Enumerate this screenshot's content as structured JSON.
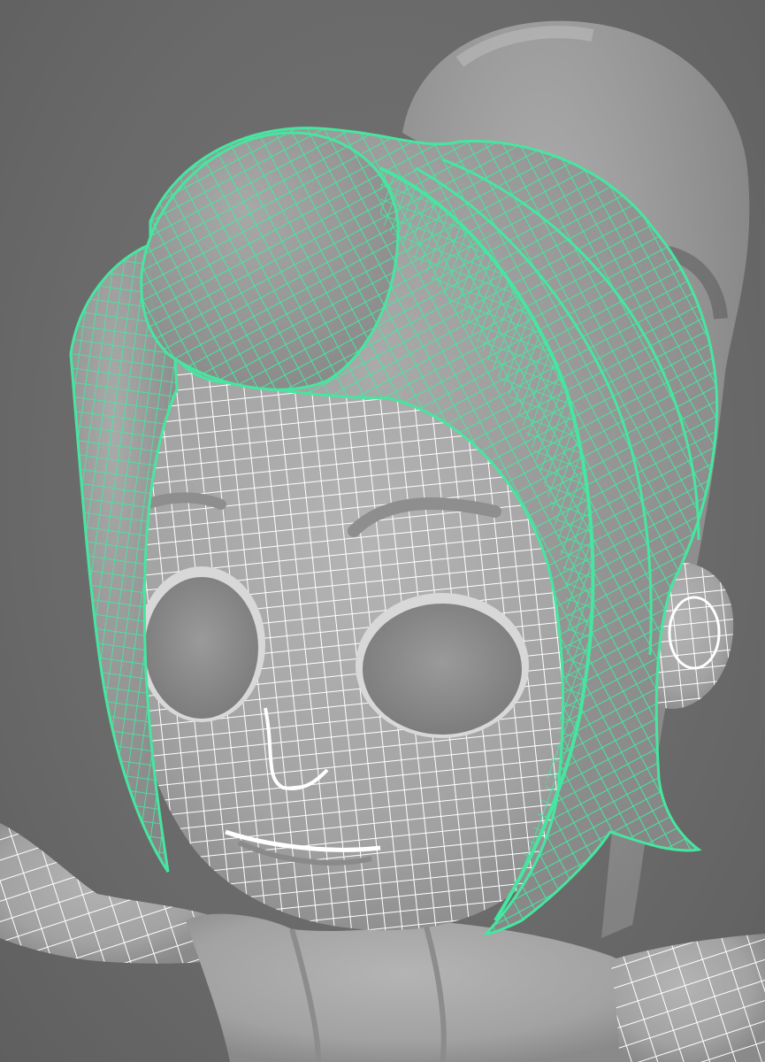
{
  "scene": {
    "description_visible_text": "",
    "colors": {
      "background": "#6e6e6e",
      "surface": "#a6a6a6",
      "surface_shadow": "#7c7c7c",
      "body_wire": "#ffffff",
      "hair_wire": "#46e6a0",
      "eye_socket": "#8e8e8e"
    },
    "objects": [
      {
        "name": "ponytail",
        "wireframe": "none"
      },
      {
        "name": "head",
        "wireframe": "white"
      },
      {
        "name": "hair-bangs",
        "wireframe": "green-selected"
      },
      {
        "name": "left-ear",
        "wireframe": "white"
      },
      {
        "name": "eyes",
        "wireframe": "none"
      },
      {
        "name": "eyebrows",
        "wireframe": "none"
      },
      {
        "name": "neck-torso",
        "wireframe": "none"
      },
      {
        "name": "left-arm",
        "wireframe": "white"
      },
      {
        "name": "right-arm",
        "wireframe": "white"
      }
    ]
  }
}
